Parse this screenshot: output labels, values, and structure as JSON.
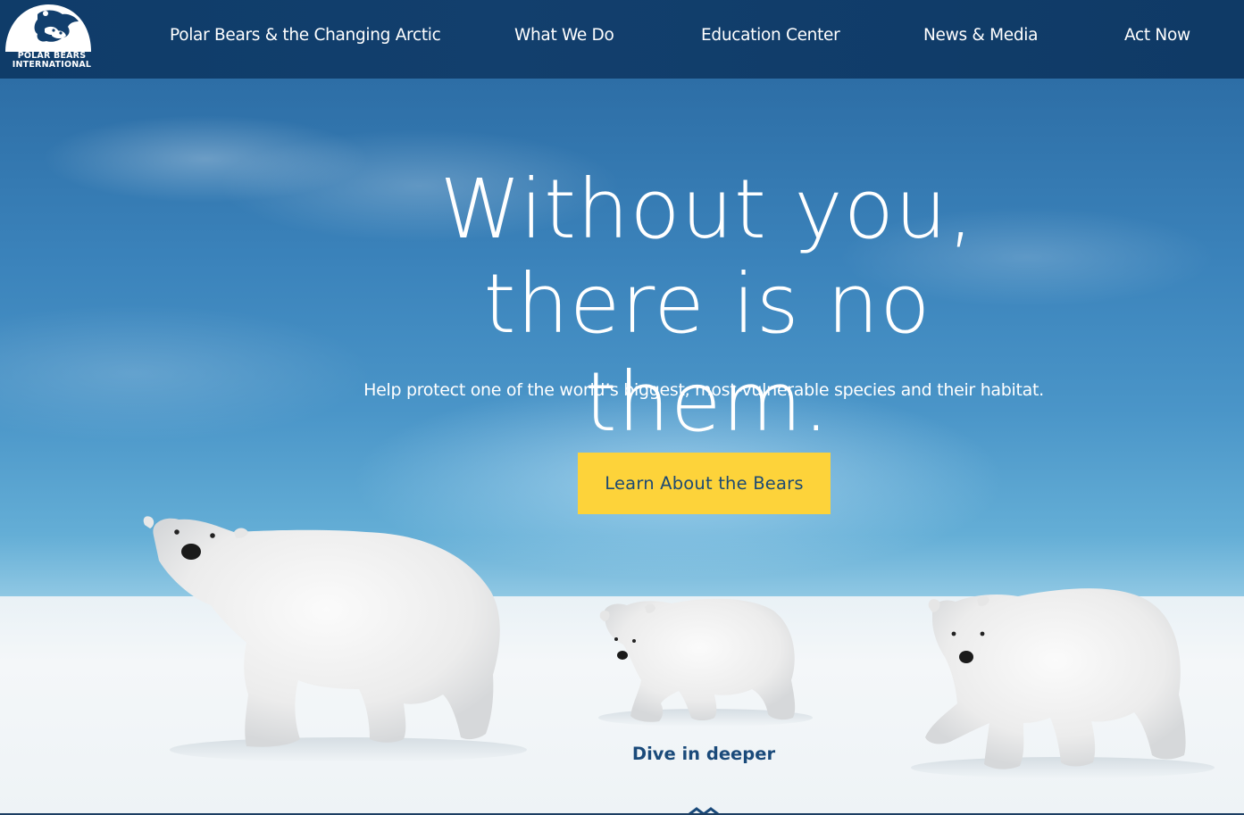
{
  "header": {
    "logo_line1": "POLAR BEARS",
    "logo_line2": "INTERNATIONAL",
    "nav": [
      {
        "label": "Polar Bears & the Changing Arctic"
      },
      {
        "label": "What We Do"
      },
      {
        "label": "Education Center"
      },
      {
        "label": "News & Media"
      },
      {
        "label": "Act Now"
      }
    ]
  },
  "hero": {
    "headline_line1": "Without you,",
    "headline_line2": "there is no them.",
    "subline": "Help protect one of the world’s biggest, most-vulnerable species and their habitat.",
    "cta_label": "Learn About the Bears",
    "dive_label": "Dive in deeper"
  },
  "colors": {
    "header_bg": "#0f3c69",
    "cta_bg": "#fdd33a",
    "cta_text": "#1d4a73",
    "dive_text": "#1a4a7a"
  },
  "icons": {
    "logo": "polar-bear-logo-icon",
    "scroll": "chevron-down-icon"
  }
}
